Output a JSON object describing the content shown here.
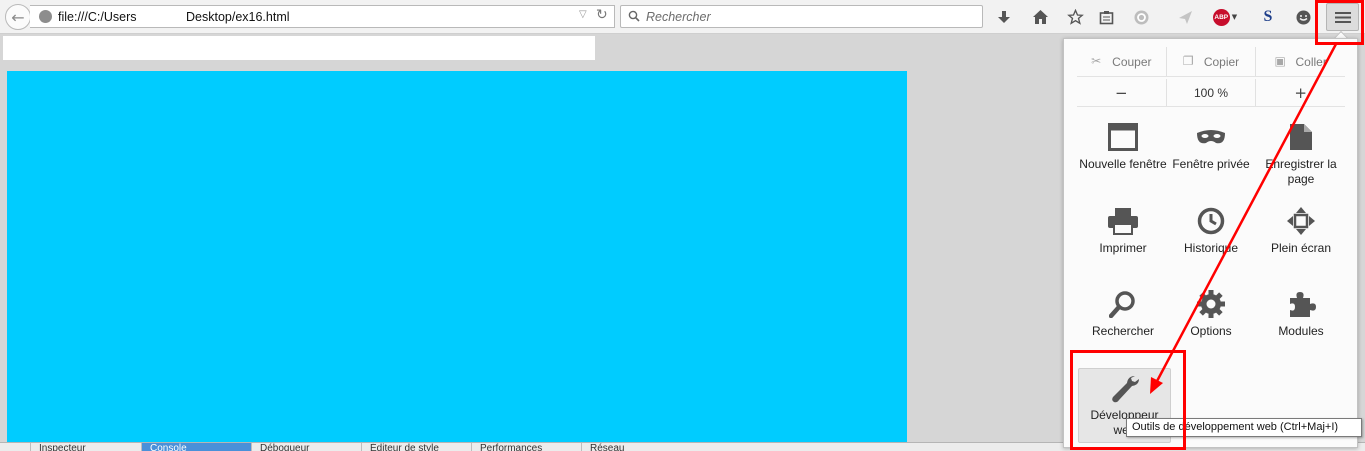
{
  "toolbar": {
    "url_prefix": "file:///C:/Users",
    "url_suffix": "Desktop/ex16.html",
    "search_placeholder": "Rechercher",
    "abp_label": "ABP",
    "s_label": "S"
  },
  "menu": {
    "edit": {
      "cut": "Couper",
      "copy": "Copier",
      "paste": "Coller"
    },
    "zoom": {
      "minus": "−",
      "level": "100 %",
      "plus": "+"
    },
    "items": [
      {
        "label": "Nouvelle fenêtre",
        "icon": "new-window-icon"
      },
      {
        "label": "Fenêtre privée",
        "icon": "private-mask-icon"
      },
      {
        "label": "Enregistrer la page",
        "icon": "save-page-icon"
      },
      {
        "label": "Imprimer",
        "icon": "printer-icon"
      },
      {
        "label": "Historique",
        "icon": "history-clock-icon"
      },
      {
        "label": "Plein écran",
        "icon": "fullscreen-icon"
      },
      {
        "label": "Rechercher",
        "icon": "search-icon"
      },
      {
        "label": "Options",
        "icon": "gear-icon"
      },
      {
        "label": "Modules",
        "icon": "puzzle-icon"
      }
    ],
    "developer": {
      "label": "Développeur web",
      "icon": "wrench-icon"
    }
  },
  "tooltip": "Outils de développement web (Ctrl+Maj+I)",
  "devtools_tabs": [
    "Inspecteur",
    "Console",
    "Débogueur",
    "Éditeur de style",
    "Performances",
    "Réseau"
  ],
  "colors": {
    "page_bg": "#00ccff",
    "annotation": "#ff0000"
  }
}
